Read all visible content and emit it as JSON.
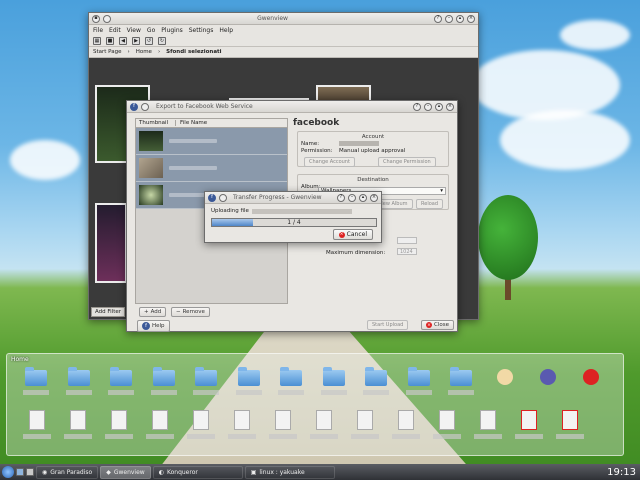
{
  "gwenview": {
    "title": "Gwenview",
    "menu": [
      "File",
      "Edit",
      "View",
      "Go",
      "Plugins",
      "Settings",
      "Help"
    ],
    "breadcrumb": {
      "start": "Start Page",
      "home": "Home",
      "folder": "Sfondi selezionati"
    },
    "add_filter": "Add Filter"
  },
  "export": {
    "title": "Export to Facebook Web Service",
    "columns": [
      "Thumbnail",
      "File Name"
    ],
    "files": [
      "walker_1600.jpg",
      "Lines of Sand.jpg",
      "strange...jpg"
    ],
    "add_label": "Add",
    "remove_label": "Remove",
    "brand": "facebook",
    "account_heading": "Account",
    "name_label": "Name:",
    "permission_label": "Permission:",
    "permission_value": "Manual upload approval",
    "change_account": "Change Account",
    "change_permission": "Change Permission",
    "destination_heading": "Destination",
    "album_label": "Album:",
    "album_value": "Wallpapers",
    "new_album": "New Album",
    "reload": "Reload",
    "max_dimension_label": "Maximum dimension:",
    "max_dimension_value": "1024",
    "help": "Help",
    "start_upload": "Start Upload",
    "close": "Close"
  },
  "progress": {
    "title": "Transfer Progress - Gwenview",
    "uploading_label": "Uploading file",
    "value": 1,
    "total": 4,
    "bar_text": "1 / 4",
    "cancel": "Cancel"
  },
  "folderview": {
    "title": "Home"
  },
  "taskbar": {
    "tasks": [
      "Gran Paradiso",
      "Gwenview",
      "Konqueror",
      "linux : yakuake"
    ],
    "clock": "19:13"
  },
  "colors": {
    "selection": "#8a99ab",
    "progress": "#4f86c9",
    "facebook": "#3b5998"
  }
}
